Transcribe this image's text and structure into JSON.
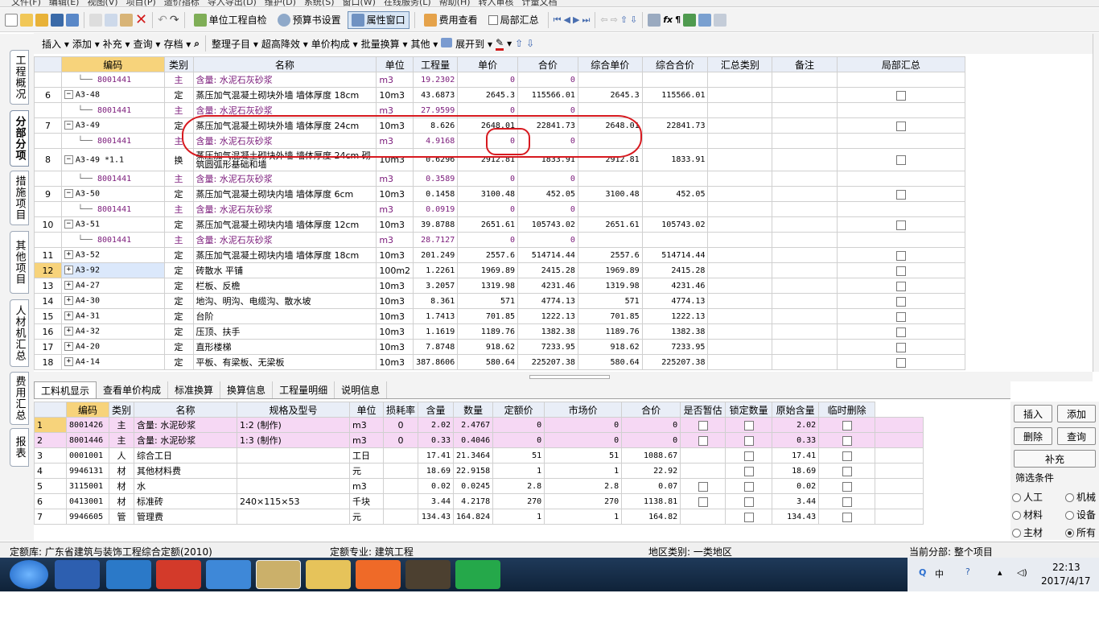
{
  "menubar": {
    "items": [
      "文件(F)",
      "编辑(E)",
      "视图(V)",
      "项目(P)",
      "造价指标",
      "导入导出(D)",
      "维护(D)",
      "系统(S)",
      "窗口(W)",
      "在线服务(L)",
      "帮助(H)",
      "转入审核",
      "计量文档"
    ]
  },
  "toolbar1": {
    "self_check": "单位工程自检",
    "budget_settings": "预算书设置",
    "property_window": "属性窗口",
    "fee_view": "费用查看",
    "local_summary": "局部汇总"
  },
  "toolbar2": {
    "insert": "插入",
    "add": "添加",
    "supplement": "补充",
    "query": "查询",
    "save": "存档",
    "organize": "整理子目",
    "over_height": "超高降效",
    "unit_composition": "单价构成",
    "batch_convert": "批量换算",
    "other": "其他",
    "expand_to": "展开到"
  },
  "left_tabs": [
    "工程概况",
    "分部分项",
    "措施项目",
    "其他项目",
    "人材机汇总",
    "费用汇总",
    "报表"
  ],
  "main_grid": {
    "headers": [
      "编码",
      "类别",
      "名称",
      "单位",
      "工程量",
      "单价",
      "合价",
      "综合单价",
      "综合合价",
      "汇总类别",
      "备注",
      "局部汇总"
    ],
    "rows": [
      {
        "n": "",
        "code": "8001441",
        "type": "主",
        "name": "含量: 水泥石灰砂浆",
        "unit": "m3",
        "qty": "19.2302",
        "price": "0",
        "total": "0",
        "cu": "",
        "ct": "",
        "sub": true,
        "cb": false
      },
      {
        "n": "6",
        "code": "A3-48",
        "type": "定",
        "name": "蒸压加气混凝土砌块外墙 墙体厚度 18cm",
        "unit": "10m3",
        "qty": "43.6873",
        "price": "2645.3",
        "total": "115566.01",
        "cu": "2645.3",
        "ct": "115566.01",
        "exp": "−",
        "cb": true
      },
      {
        "n": "",
        "code": "8001441",
        "type": "主",
        "name": "含量: 水泥石灰砂浆",
        "unit": "m3",
        "qty": "27.9599",
        "price": "0",
        "total": "0",
        "cu": "",
        "ct": "",
        "sub": true,
        "cb": false
      },
      {
        "n": "7",
        "code": "A3-49",
        "type": "定",
        "name": "蒸压加气混凝土砌块外墙 墙体厚度 24cm",
        "unit": "10m3",
        "qty": "8.626",
        "price": "2648.01",
        "total": "22841.73",
        "cu": "2648.01",
        "ct": "22841.73",
        "exp": "−",
        "cb": true
      },
      {
        "n": "",
        "code": "8001441",
        "type": "主",
        "name": "含量: 水泥石灰砂浆",
        "unit": "m3",
        "qty": "4.9168",
        "price": "0",
        "total": "0",
        "cu": "",
        "ct": "",
        "sub": true,
        "cb": false
      },
      {
        "n": "8",
        "code": "A3-49 *1.1",
        "type": "换",
        "name": "蒸压加气混凝土砌块外墙 墙体厚度 24cm 砌筑圆弧形基础和墙",
        "unit": "10m3",
        "qty": "0.6296",
        "price": "2912.81",
        "total": "1833.91",
        "cu": "2912.81",
        "ct": "1833.91",
        "exp": "−",
        "cb": true,
        "tall": true
      },
      {
        "n": "",
        "code": "8001441",
        "type": "主",
        "name": "含量: 水泥石灰砂浆",
        "unit": "m3",
        "qty": "0.3589",
        "price": "0",
        "total": "0",
        "cu": "",
        "ct": "",
        "sub": true,
        "cb": false
      },
      {
        "n": "9",
        "code": "A3-50",
        "type": "定",
        "name": "蒸压加气混凝土砌块内墙 墙体厚度 6cm",
        "unit": "10m3",
        "qty": "0.1458",
        "price": "3100.48",
        "total": "452.05",
        "cu": "3100.48",
        "ct": "452.05",
        "exp": "−",
        "cb": true
      },
      {
        "n": "",
        "code": "8001441",
        "type": "主",
        "name": "含量: 水泥石灰砂浆",
        "unit": "m3",
        "qty": "0.0919",
        "price": "0",
        "total": "0",
        "cu": "",
        "ct": "",
        "sub": true,
        "cb": false
      },
      {
        "n": "10",
        "code": "A3-51",
        "type": "定",
        "name": "蒸压加气混凝土砌块内墙 墙体厚度 12cm",
        "unit": "10m3",
        "qty": "39.8788",
        "price": "2651.61",
        "total": "105743.02",
        "cu": "2651.61",
        "ct": "105743.02",
        "exp": "−",
        "cb": true
      },
      {
        "n": "",
        "code": "8001441",
        "type": "主",
        "name": "含量: 水泥石灰砂浆",
        "unit": "m3",
        "qty": "28.7127",
        "price": "0",
        "total": "0",
        "cu": "",
        "ct": "",
        "sub": true,
        "cb": false
      },
      {
        "n": "11",
        "code": "A3-52",
        "type": "定",
        "name": "蒸压加气混凝土砌块内墙 墙体厚度 18cm",
        "unit": "10m3",
        "qty": "201.249",
        "price": "2557.6",
        "total": "514714.44",
        "cu": "2557.6",
        "ct": "514714.44",
        "exp": "+",
        "cb": true
      },
      {
        "n": "12",
        "code": "A3-92",
        "type": "定",
        "name": "砖散水 平铺",
        "unit": "100m2",
        "qty": "1.2261",
        "price": "1969.89",
        "total": "2415.28",
        "cu": "1969.89",
        "ct": "2415.28",
        "exp": "+",
        "cb": true,
        "sel": true
      },
      {
        "n": "13",
        "code": "A4-27",
        "type": "定",
        "name": "栏板、反檐",
        "unit": "10m3",
        "qty": "3.2057",
        "price": "1319.98",
        "total": "4231.46",
        "cu": "1319.98",
        "ct": "4231.46",
        "exp": "+",
        "cb": true
      },
      {
        "n": "14",
        "code": "A4-30",
        "type": "定",
        "name": "地沟、明沟、电缆沟、散水坡",
        "unit": "10m3",
        "qty": "8.361",
        "price": "571",
        "total": "4774.13",
        "cu": "571",
        "ct": "4774.13",
        "exp": "+",
        "cb": true
      },
      {
        "n": "15",
        "code": "A4-31",
        "type": "定",
        "name": "台阶",
        "unit": "10m3",
        "qty": "1.7413",
        "price": "701.85",
        "total": "1222.13",
        "cu": "701.85",
        "ct": "1222.13",
        "exp": "+",
        "cb": true
      },
      {
        "n": "16",
        "code": "A4-32",
        "type": "定",
        "name": "压顶、扶手",
        "unit": "10m3",
        "qty": "1.1619",
        "price": "1189.76",
        "total": "1382.38",
        "cu": "1189.76",
        "ct": "1382.38",
        "exp": "+",
        "cb": true
      },
      {
        "n": "17",
        "code": "A4-20",
        "type": "定",
        "name": "直形楼梯",
        "unit": "10m3",
        "qty": "7.8748",
        "price": "918.62",
        "total": "7233.95",
        "cu": "918.62",
        "ct": "7233.95",
        "exp": "+",
        "cb": true
      },
      {
        "n": "18",
        "code": "A4-14",
        "type": "定",
        "name": "平板、有梁板、无梁板",
        "unit": "10m3",
        "qty": "387.8606",
        "price": "580.64",
        "total": "225207.38",
        "cu": "580.64",
        "ct": "225207.38",
        "exp": "+",
        "cb": true
      }
    ]
  },
  "bottom_tabs": [
    "工料机显示",
    "查看单价构成",
    "标准换算",
    "换算信息",
    "工程量明细",
    "说明信息"
  ],
  "bottom_grid": {
    "headers": [
      "编码",
      "类别",
      "名称",
      "规格及型号",
      "单位",
      "损耗率",
      "含量",
      "数量",
      "定额价",
      "市场价",
      "合价",
      "是否暂估",
      "锁定数量",
      "原始含量",
      "临时删除"
    ],
    "rows": [
      {
        "n": "1",
        "code": "8001426",
        "type": "主",
        "name": "含量: 水泥砂浆",
        "spec": "1:2 (制作)",
        "unit": "m3",
        "loss": "0",
        "content": "2.02",
        "qty": "2.4767",
        "price": "0",
        "market": "0",
        "total": "0",
        "orig": "2.02",
        "est": true,
        "pink": true
      },
      {
        "n": "2",
        "code": "8001446",
        "type": "主",
        "name": "含量: 水泥砂浆",
        "spec": "1:3 (制作)",
        "unit": "m3",
        "loss": "0",
        "content": "0.33",
        "qty": "0.4046",
        "price": "0",
        "market": "0",
        "total": "0",
        "orig": "0.33",
        "est": true,
        "pink": true
      },
      {
        "n": "3",
        "code": "0001001",
        "type": "人",
        "name": "综合工日",
        "spec": "",
        "unit": "工日",
        "loss": "",
        "content": "17.41",
        "qty": "21.3464",
        "price": "51",
        "market": "51",
        "total": "1088.67",
        "orig": "17.41",
        "est": false
      },
      {
        "n": "4",
        "code": "9946131",
        "type": "材",
        "name": "其他材料费",
        "spec": "",
        "unit": "元",
        "loss": "",
        "content": "18.69",
        "qty": "22.9158",
        "price": "1",
        "market": "1",
        "total": "22.92",
        "orig": "18.69",
        "est": false
      },
      {
        "n": "5",
        "code": "3115001",
        "type": "材",
        "name": "水",
        "spec": "",
        "unit": "m3",
        "loss": "",
        "content": "0.02",
        "qty": "0.0245",
        "price": "2.8",
        "market": "2.8",
        "total": "0.07",
        "orig": "0.02",
        "est": true
      },
      {
        "n": "6",
        "code": "0413001",
        "type": "材",
        "name": "标准砖",
        "spec": "240×115×53",
        "unit": "千块",
        "loss": "",
        "content": "3.44",
        "qty": "4.2178",
        "price": "270",
        "market": "270",
        "total": "1138.81",
        "orig": "3.44",
        "est": true
      },
      {
        "n": "7",
        "code": "9946605",
        "type": "管",
        "name": "管理费",
        "spec": "",
        "unit": "元",
        "loss": "",
        "content": "134.43",
        "qty": "164.824",
        "price": "1",
        "market": "1",
        "total": "164.82",
        "orig": "134.43",
        "est": false
      }
    ]
  },
  "right_panel": {
    "insert": "插入",
    "add": "添加",
    "delete": "删除",
    "query": "查询",
    "supplement": "补充",
    "filter_title": "筛选条件",
    "filters": [
      "人工",
      "机械",
      "材料",
      "设备",
      "主材",
      "所有"
    ]
  },
  "statusbar": {
    "quota_lib": "定额库: 广东省建筑与装饰工程综合定额(2010)",
    "quota_major": "定额专业: 建筑工程",
    "region": "地区类别: 一类地区",
    "current_part": "当前分部: 整个项目"
  },
  "tray": {
    "ime": "中",
    "time": "22:13",
    "date": "2017/4/17"
  },
  "colors": {
    "header_bg": "#e9eef7",
    "selected": "#f7d37b",
    "sub_text": "#7a1a7a",
    "annotation": "#d7191f",
    "pink_row": "#f6d8f4"
  }
}
